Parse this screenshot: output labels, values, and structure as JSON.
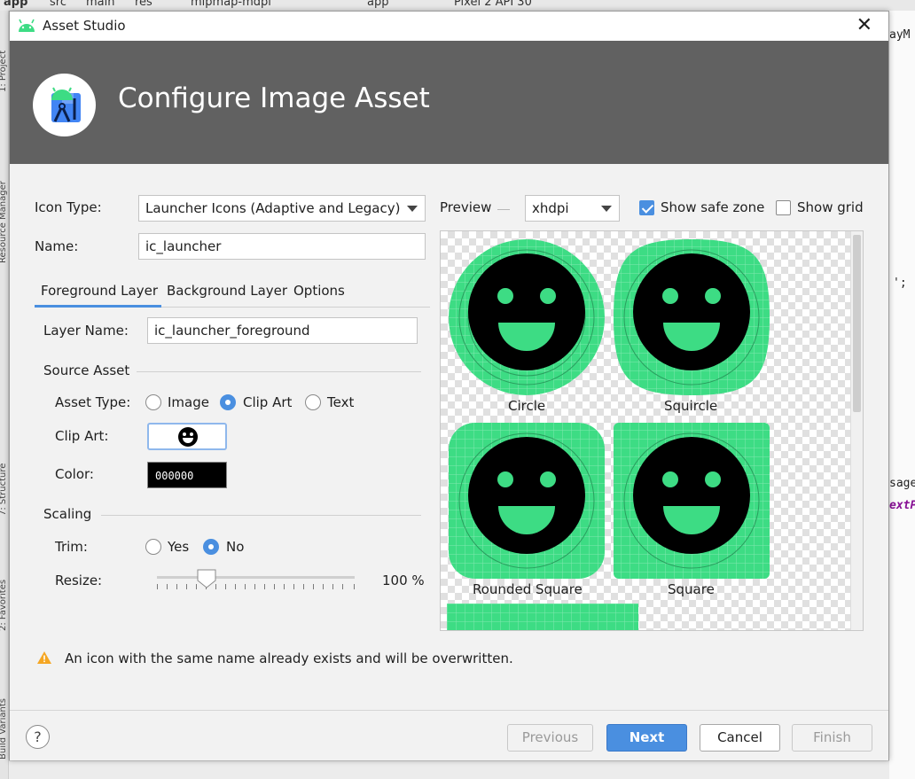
{
  "ide": {
    "breadcrumbs": [
      "app",
      "src",
      "main",
      "res",
      "mipmap-mdpi"
    ],
    "run_config": "app",
    "device": "Pixel 2 API 30",
    "left_tools": [
      "1: Project",
      "Resource Manager",
      "7: Structure",
      "2: Favorites",
      "Build Variants"
    ],
    "code_fragments": [
      "ayM",
      "';",
      "sage",
      "extP"
    ]
  },
  "dialog": {
    "window_title": "Asset Studio",
    "heading": "Configure Image Asset",
    "icon_type_label": "Icon Type:",
    "icon_type_value": "Launcher Icons (Adaptive and Legacy)",
    "name_label": "Name:",
    "name_value": "ic_launcher",
    "tabs": [
      {
        "label": "Foreground Layer",
        "active": true
      },
      {
        "label": "Background Layer",
        "active": false
      },
      {
        "label": "Options",
        "active": false
      }
    ],
    "layer_name_label": "Layer Name:",
    "layer_name_value": "ic_launcher_foreground",
    "source_asset_heading": "Source Asset",
    "asset_type_label": "Asset Type:",
    "asset_type_options": [
      "Image",
      "Clip Art",
      "Text"
    ],
    "asset_type_selected": "Clip Art",
    "clip_art_label": "Clip Art:",
    "color_label": "Color:",
    "color_value": "000000",
    "scaling_heading": "Scaling",
    "trim_label": "Trim:",
    "trim_options": [
      "Yes",
      "No"
    ],
    "trim_selected": "No",
    "resize_label": "Resize:",
    "resize_value": "100 %",
    "resize_fraction": 0.25,
    "preview_label": "Preview",
    "density_value": "xhdpi",
    "show_safe_zone_label": "Show safe zone",
    "show_safe_zone_checked": true,
    "show_grid_label": "Show grid",
    "show_grid_checked": false,
    "preview_shapes": [
      "Circle",
      "Squircle",
      "Rounded Square",
      "Square"
    ],
    "warning_text": "An icon with the same name already exists and will be overwritten.",
    "help_label": "?",
    "buttons": {
      "previous": "Previous",
      "next": "Next",
      "cancel": "Cancel",
      "finish": "Finish"
    }
  },
  "colors": {
    "icon_green": "#3ddc84",
    "accent_blue": "#4a8fe0",
    "banner_gray": "#616161",
    "warning_amber": "#f5a623"
  }
}
